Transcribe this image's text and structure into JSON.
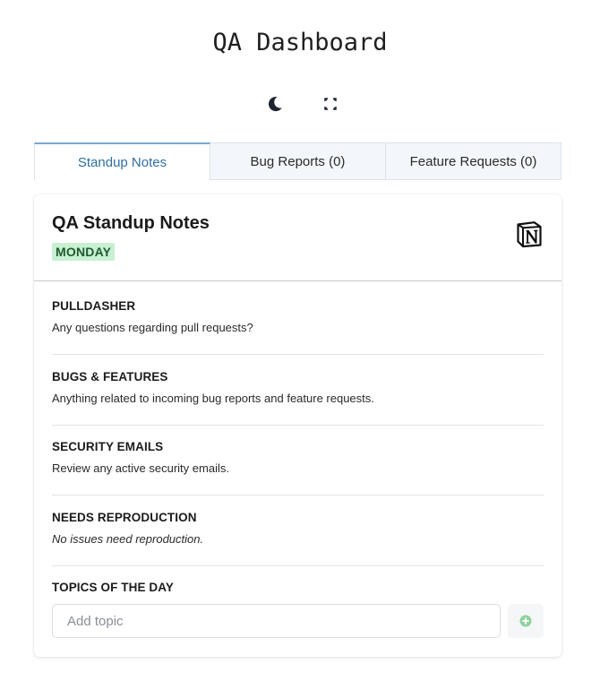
{
  "app": {
    "title": "QA Dashboard"
  },
  "controls": {
    "theme_icon": "moon-icon",
    "fullscreen_icon": "expand-icon"
  },
  "tabs": [
    {
      "label": "Standup Notes",
      "active": true
    },
    {
      "label": "Bug Reports (0)",
      "active": false
    },
    {
      "label": "Feature Requests (0)",
      "active": false
    }
  ],
  "card": {
    "title": "QA Standup Notes",
    "day": "MONDAY",
    "notion_icon": "notion-logo-icon",
    "sections": [
      {
        "title": "PULLDASHER",
        "text": "Any questions regarding pull requests?"
      },
      {
        "title": "BUGS & FEATURES",
        "text": "Anything related to incoming bug reports and feature requests."
      },
      {
        "title": "SECURITY EMAILS",
        "text": "Review any active security emails."
      },
      {
        "title": "NEEDS REPRODUCTION",
        "text": "No issues need reproduction."
      },
      {
        "title": "TOPICS OF THE DAY",
        "text": ""
      }
    ],
    "topic_input": {
      "value": "",
      "placeholder": "Add topic"
    },
    "add_icon": "plus-circle-icon"
  },
  "colors": {
    "accent": "#2f6fa3",
    "badge_bg": "#c8f0d2",
    "badge_text": "#1f5b2e",
    "add_icon": "#8fd19e"
  }
}
